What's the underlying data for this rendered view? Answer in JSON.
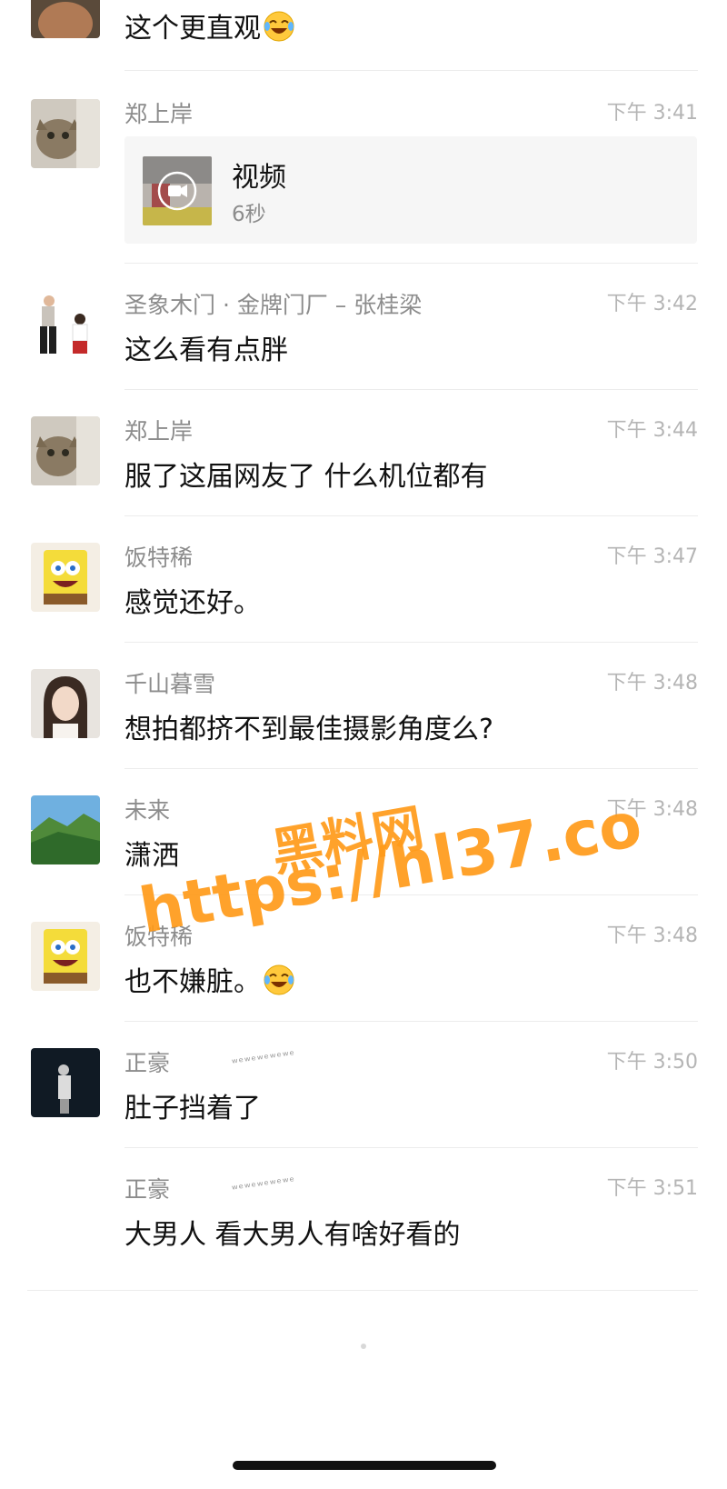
{
  "messages": [
    {
      "sender": "",
      "time": "",
      "text": "这个更直观",
      "emoji": "laugh-crying-emoji"
    },
    {
      "sender": "郑上岸",
      "time": "下午 3:41",
      "type": "video",
      "video_title": "视频",
      "video_duration": "6秒"
    },
    {
      "sender": "圣象木门 · 金牌门厂 – 张桂梁",
      "time": "下午 3:42",
      "text": "这么看有点胖"
    },
    {
      "sender": "郑上岸",
      "time": "下午 3:44",
      "text": "服了这届网友了 什么机位都有"
    },
    {
      "sender": "饭特稀",
      "time": "下午 3:47",
      "text": "感觉还好。"
    },
    {
      "sender": "千山暮雪",
      "time": "下午 3:48",
      "text": "想拍都挤不到最佳摄影角度么?"
    },
    {
      "sender": "未来",
      "time": "下午 3:48",
      "text": "潇洒"
    },
    {
      "sender": "饭特稀",
      "time": "下午 3:48",
      "text": "也不嫌脏。",
      "emoji": "laugh-crying-emoji"
    },
    {
      "sender": "正豪",
      "time": "下午 3:50",
      "text": "肚子挡着了"
    },
    {
      "sender": "正豪",
      "time": "下午 3:51",
      "text": "大男人 看大男人有啥好看的"
    }
  ],
  "watermark": {
    "title": "黑料网",
    "url": "https://hl37.co"
  },
  "colors": {
    "sender": "#8c8c8c",
    "time": "#b5b5b5",
    "watermark": "#ff9b1a"
  }
}
